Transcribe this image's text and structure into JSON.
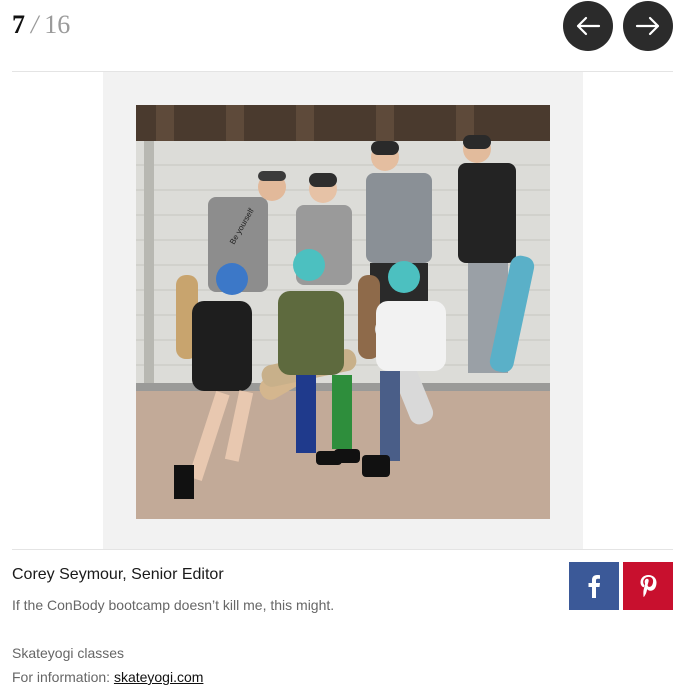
{
  "pager": {
    "current": "7",
    "separator": "/",
    "total": "16"
  },
  "nav": {
    "prev_icon": "arrow-left-icon",
    "next_icon": "arrow-right-icon"
  },
  "photo": {
    "tshirt_text": "Be yourself"
  },
  "credit": "Corey Seymour, Senior Editor",
  "caption": "If the ConBody bootcamp doesn’t kill me, this might.",
  "info": {
    "title": "Skateyogi classes",
    "label": "For information: ",
    "link_text": "skateyogi.com"
  },
  "share": {
    "facebook_icon": "facebook-icon",
    "pinterest_icon": "pinterest-icon"
  },
  "colors": {
    "facebook": "#3b5998",
    "pinterest": "#c8102e",
    "nav": "#2b2b2b"
  }
}
